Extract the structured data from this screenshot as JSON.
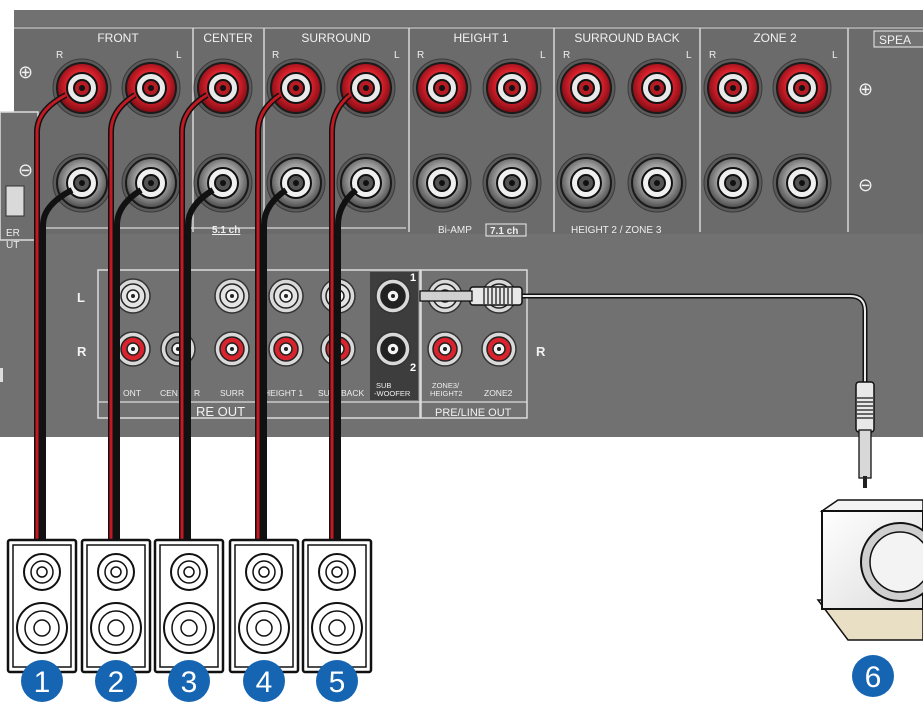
{
  "speaker_terminals": {
    "section_title_partial": "SPEA",
    "groups": [
      {
        "name": "FRONT",
        "r": "R",
        "l": "L"
      },
      {
        "name": "CENTER",
        "r": "",
        "l": ""
      },
      {
        "name": "SURROUND",
        "r": "R",
        "l": "L"
      },
      {
        "name": "HEIGHT 1",
        "r": "R",
        "l": "L"
      },
      {
        "name": "SURROUND BACK",
        "r": "R",
        "l": "L"
      },
      {
        "name": "ZONE 2",
        "r": "R",
        "l": "L"
      }
    ],
    "plus_symbol": "⊕",
    "minus_symbol": "⊖",
    "label_51ch": "5.1 ch",
    "label_biamp": "Bi-AMP",
    "label_71ch": "7.1 ch",
    "label_height2_zone3": "HEIGHT 2 / ZONE 3",
    "cut_label_1": "ER",
    "cut_label_2": "UT"
  },
  "pre_out": {
    "row_l": "L",
    "row_r": "R",
    "labels": [
      "FRONT",
      "CENTER",
      "SURR",
      "HEIGHT 1",
      "SURR BACK"
    ],
    "visible_labels": [
      "ONT",
      "CEN",
      "R",
      "SURR",
      "HEIGHT 1",
      "SU",
      "BACK"
    ],
    "subwoofer_label": [
      "SUB",
      "-WOOFER"
    ],
    "sub_num_1": "1",
    "sub_num_2": "2",
    "title_visible": "RE OUT"
  },
  "pre_line_out": {
    "zone3_label": [
      "ZONE3/",
      "HEIGHT2"
    ],
    "zone2_label": "ZONE2",
    "title": "PRE/LINE OUT",
    "row_l": "L",
    "row_r": "R"
  },
  "speakers": [
    {
      "number": "1"
    },
    {
      "number": "2"
    },
    {
      "number": "3"
    },
    {
      "number": "4"
    },
    {
      "number": "5"
    }
  ],
  "subwoofer": {
    "number": "6"
  },
  "colors": {
    "panel": "#727272",
    "panel_dark": "#5e5e5e",
    "terminal_red": "#c8202a",
    "badge_blue": "#1565b3",
    "wire_red": "#b3151d"
  }
}
